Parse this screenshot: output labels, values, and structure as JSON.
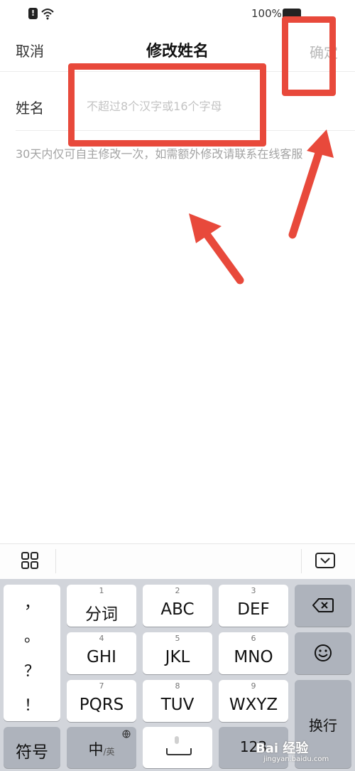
{
  "status_bar": {
    "battery_percent": "100%"
  },
  "nav": {
    "cancel_label": "取消",
    "title": "修改姓名",
    "confirm_label": "确定"
  },
  "form": {
    "name_label": "姓名",
    "name_value": "",
    "name_placeholder": "不超过8个汉字或16个字母",
    "hint": "30天内仅可自主修改一次，如需额外修改请联系在线客服"
  },
  "keyboard": {
    "toolbar": {
      "grid_icon": "grid-icon",
      "hide_icon": "keyboard-hide-icon"
    },
    "punctuation": [
      "，",
      "。",
      "？",
      "！"
    ],
    "keys": [
      {
        "num": "1",
        "label": "分词"
      },
      {
        "num": "2",
        "label": "ABC"
      },
      {
        "num": "3",
        "label": "DEF"
      },
      {
        "num": "4",
        "label": "GHI"
      },
      {
        "num": "5",
        "label": "JKL"
      },
      {
        "num": "6",
        "label": "MNO"
      },
      {
        "num": "7",
        "label": "PQRS"
      },
      {
        "num": "8",
        "label": "TUV"
      },
      {
        "num": "9",
        "label": "WXYZ"
      }
    ],
    "symbol_label": "符号",
    "chinese_label": "中",
    "english_sub_label": "/英",
    "numeric_label": "123",
    "enter_label": "换行",
    "delete_icon": "backspace-icon",
    "emoji_icon": "emoji-icon",
    "mic_icon": "microphone-icon"
  },
  "watermark": {
    "text": "Bai 经验",
    "sub": "jingyan.baidu.com"
  },
  "colors": {
    "annotation_red": "#e8493b",
    "keyboard_bg": "#d2d5db",
    "key_dark": "#aeb3bc"
  }
}
